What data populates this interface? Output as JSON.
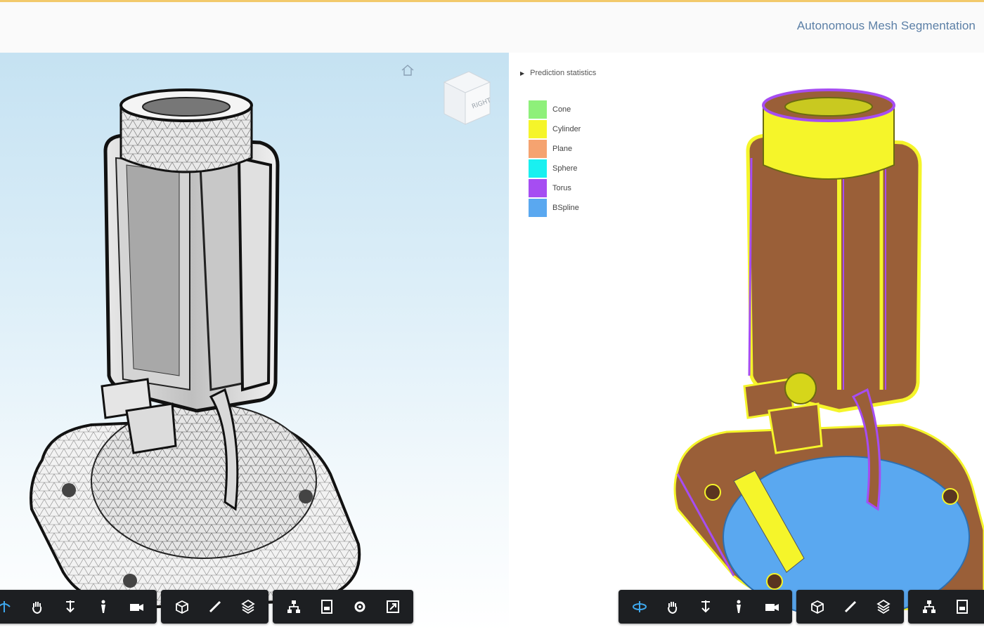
{
  "header": {
    "title": "Autonomous Mesh Segmentation"
  },
  "left_viewer": {
    "home_icon": "home-icon",
    "view_cube": {
      "face_label": "RIGHT"
    }
  },
  "right_viewer": {
    "stats_toggle": "Prediction statistics",
    "legend": [
      {
        "label": "Cone",
        "color": "#8ef07a"
      },
      {
        "label": "Cylinder",
        "color": "#f5f52a"
      },
      {
        "label": "Plane",
        "color": "#f5a370"
      },
      {
        "label": "Sphere",
        "color": "#19f0f0"
      },
      {
        "label": "Torus",
        "color": "#a64df2"
      },
      {
        "label": "BSpline",
        "color": "#5aa8f0"
      }
    ]
  },
  "toolbar_icons": [
    "orbit-icon",
    "pan-icon",
    "dolly-icon",
    "walk-icon",
    "camera-icon",
    "explode-icon",
    "measure-icon",
    "section-icon",
    "model-tree-icon",
    "properties-icon",
    "settings-icon",
    "fullscreen-icon"
  ],
  "colors": {
    "toolbar_bg": "#1d1f22",
    "accent": "#3ea8ee",
    "title": "#5b7fa6"
  }
}
